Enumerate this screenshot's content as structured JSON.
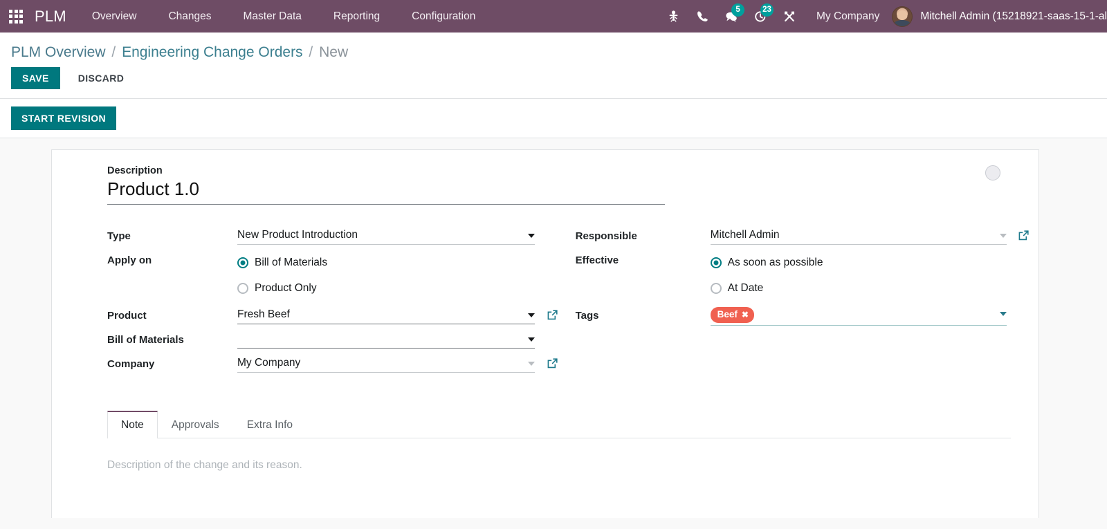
{
  "navbar": {
    "apps_icon": "apps-grid-icon",
    "brand": "PLM",
    "menu": [
      {
        "label": "Overview"
      },
      {
        "label": "Changes"
      },
      {
        "label": "Master Data"
      },
      {
        "label": "Reporting"
      },
      {
        "label": "Configuration"
      }
    ],
    "icons": [
      {
        "name": "bug-icon",
        "badge": null
      },
      {
        "name": "phone-icon",
        "badge": null
      },
      {
        "name": "messages-icon",
        "badge": "5"
      },
      {
        "name": "activity-clock-icon",
        "badge": "23"
      },
      {
        "name": "tools-icon",
        "badge": null
      }
    ],
    "company": "My Company",
    "user": "Mitchell Admin (15218921-saas-15-1-al",
    "background_color": "#6E4C65",
    "badge_color": "#00A09D"
  },
  "control_panel": {
    "breadcrumb": {
      "root": "PLM Overview",
      "sep1": "/",
      "parent": "Engineering Change Orders",
      "sep2": "/",
      "current": "New"
    },
    "save_label": "SAVE",
    "discard_label": "DISCARD",
    "action_label": "START REVISION",
    "primary_color": "#00787e"
  },
  "form": {
    "description_label": "Description",
    "description_value": "Product 1.0",
    "state_circle": "state-indicator",
    "left": {
      "type_label": "Type",
      "type_value": "New Product Introduction",
      "apply_on_label": "Apply on",
      "apply_on_options": [
        {
          "label": "Bill of Materials",
          "selected": true
        },
        {
          "label": "Product Only",
          "selected": false
        }
      ],
      "product_label": "Product",
      "product_value": "Fresh Beef",
      "bom_label": "Bill of Materials",
      "bom_value": "",
      "company_label": "Company",
      "company_value": "My Company"
    },
    "right": {
      "responsible_label": "Responsible",
      "responsible_value": "Mitchell Admin",
      "effective_label": "Effective",
      "effective_options": [
        {
          "label": "As soon as possible",
          "selected": true
        },
        {
          "label": "At Date",
          "selected": false
        }
      ],
      "tags_label": "Tags",
      "tags": [
        {
          "label": "Beef",
          "color": "#F06050",
          "remove": "✖"
        }
      ]
    },
    "notebook": {
      "tabs": [
        {
          "label": "Note",
          "active": true
        },
        {
          "label": "Approvals",
          "active": false
        },
        {
          "label": "Extra Info",
          "active": false
        }
      ],
      "note_placeholder": "Description of the change and its reason."
    }
  }
}
